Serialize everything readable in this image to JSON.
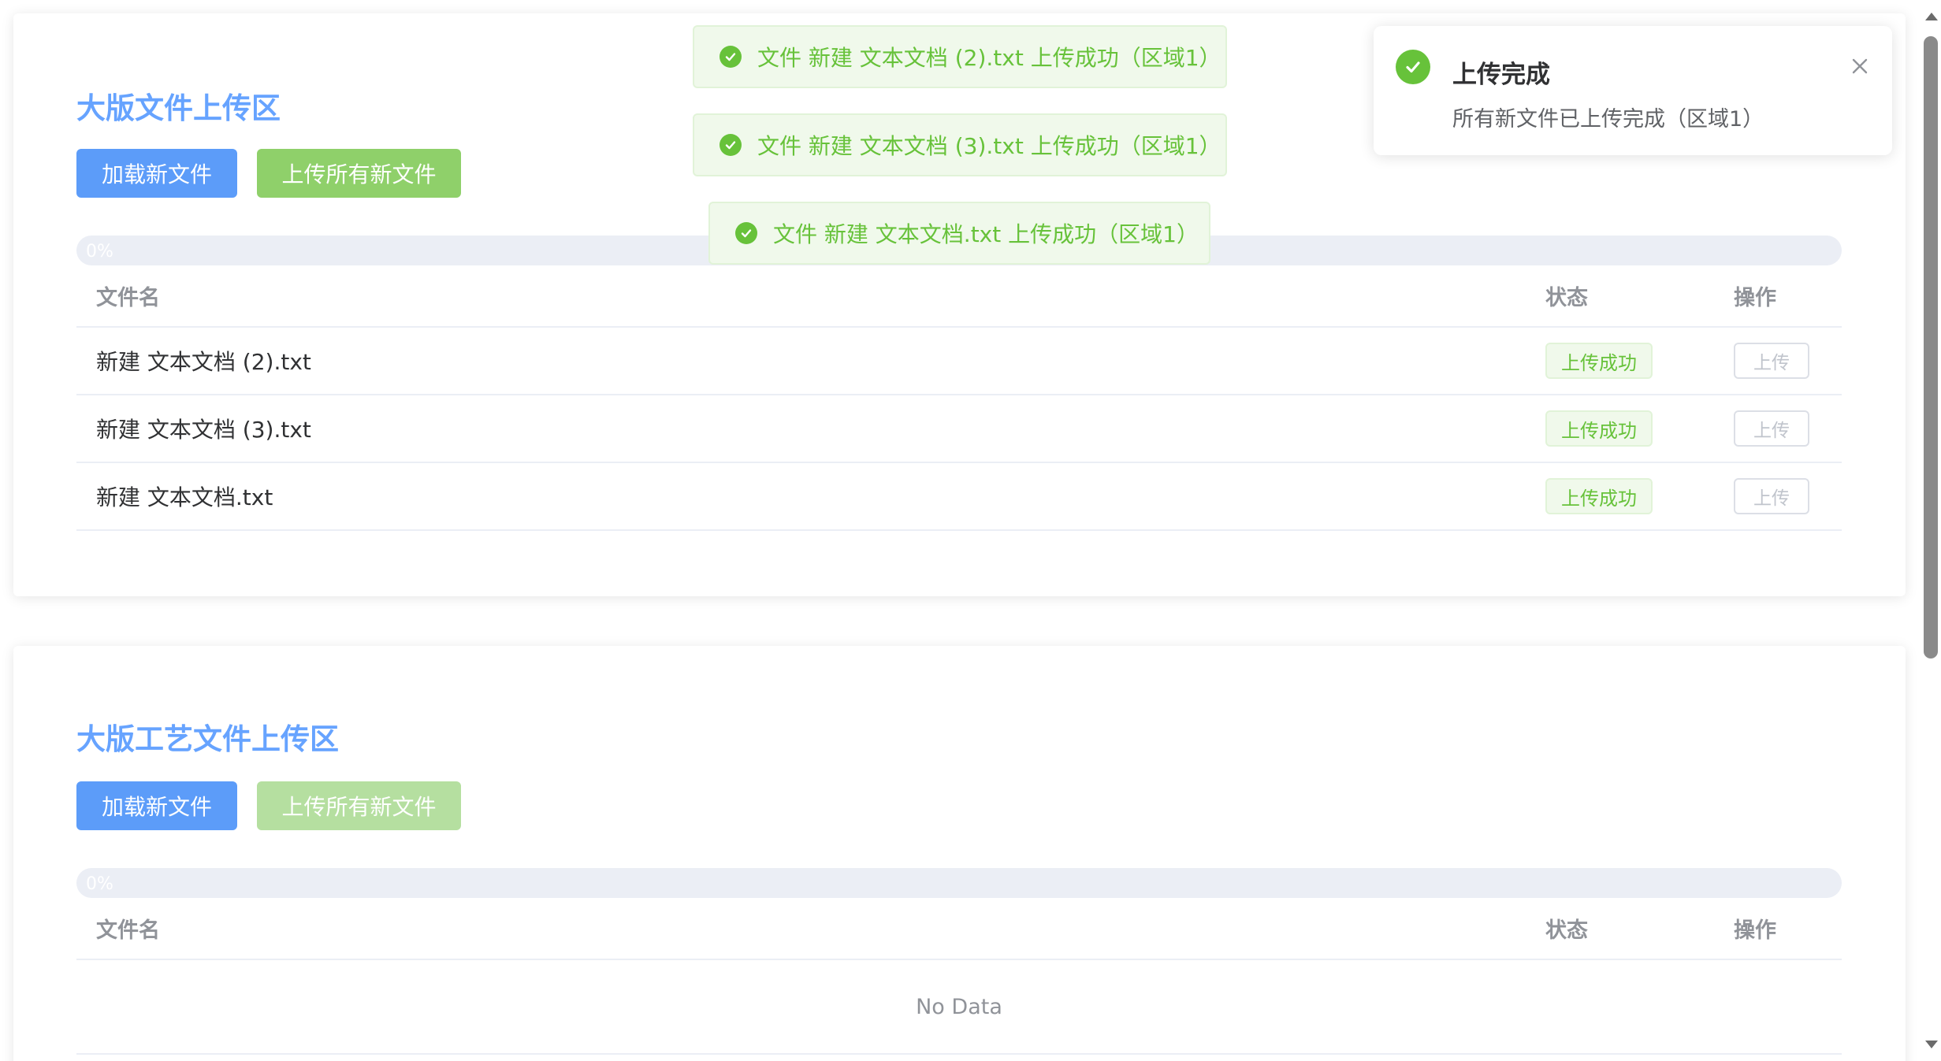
{
  "section1": {
    "title": "大版文件上传区",
    "load_label": "加载新文件",
    "upload_all_label": "上传所有新文件",
    "progress_text": "0%",
    "progress_value": 0,
    "columns": {
      "name": "文件名",
      "status": "状态",
      "ops": "操作"
    },
    "rows": [
      {
        "name": "新建 文本文档 (2).txt",
        "status": "上传成功",
        "action": "上传"
      },
      {
        "name": "新建 文本文档 (3).txt",
        "status": "上传成功",
        "action": "上传"
      },
      {
        "name": "新建 文本文档.txt",
        "status": "上传成功",
        "action": "上传"
      }
    ]
  },
  "section2": {
    "title": "大版工艺文件上传区",
    "load_label": "加载新文件",
    "upload_all_label": "上传所有新文件",
    "progress_text": "0%",
    "progress_value": 0,
    "columns": {
      "name": "文件名",
      "status": "状态",
      "ops": "操作"
    },
    "empty_text": "No Data"
  },
  "toasts": [
    "文件 新建 文本文档 (2).txt 上传成功（区域1）",
    "文件 新建 文本文档 (3).txt 上传成功（区域1）",
    "文件 新建 文本文档.txt 上传成功（区域1）"
  ],
  "notification": {
    "title": "上传完成",
    "message": "所有新文件已上传完成（区域1）"
  },
  "icons": {
    "success": "check-circle-icon",
    "close": "close-icon"
  },
  "colors": {
    "title_blue": "#66a3ff",
    "primary_button": "#5c9cf9",
    "success_button": "#8fd06a",
    "success_text": "#67c23a"
  }
}
